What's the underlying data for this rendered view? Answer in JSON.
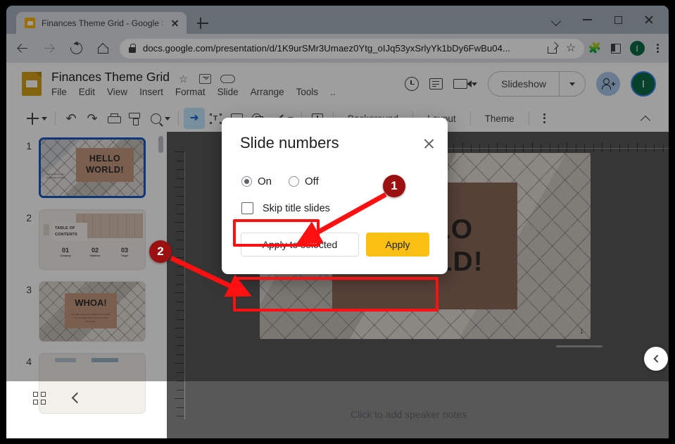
{
  "browser": {
    "tab": {
      "title": "Finances Theme Grid - Google Sli",
      "favicon": "slides-favicon",
      "close": "×"
    },
    "new_tab_label": "+",
    "window_controls": [
      "chevron-down",
      "minimize",
      "maximize",
      "close"
    ],
    "url": "docs.google.com/presentation/d/1K9urSMr3Umaez0Ytg_oIJq53yxSrlyYk1bDy6FwBu04...",
    "omnibox_icons": [
      "lock-icon",
      "share-icon",
      "bookmark-star-icon"
    ],
    "toolbar_icons": [
      "extensions-puzzle-icon",
      "side-panel-icon",
      "profile-avatar",
      "chrome-menu-icon"
    ],
    "profile_initial": "I"
  },
  "slides": {
    "doc_title": "Finances Theme Grid",
    "title_icons": [
      "star-icon",
      "move-to-folder-icon",
      "cloud-saved-icon"
    ],
    "menus": [
      "File",
      "Edit",
      "View",
      "Insert",
      "Format",
      "Slide",
      "Arrange",
      "Tools",
      ".."
    ],
    "header_right": {
      "history_icon": "version-history-icon",
      "comment_icon": "comment-icon",
      "meet_icon": "meet-camera-icon",
      "slideshow_label": "Slideshow",
      "share_icon": "person-add-icon",
      "avatar_initial": "I"
    },
    "toolbar": {
      "new_slide": "add-slide-icon",
      "undo": "undo-icon",
      "redo": "redo-icon",
      "print": "print-icon",
      "paint_format": "paint-format-icon",
      "zoom": "zoom-icon",
      "select": "cursor-select-icon",
      "textbox": "text-box-icon",
      "image": "insert-image-icon",
      "shape": "insert-shape-icon",
      "line": "insert-line-icon",
      "comment": "add-comment-icon",
      "background_label": "Background",
      "layout_label": "Layout",
      "theme_label": "Theme",
      "more_label": "more-options-icon",
      "collapse_label": "collapse-toolbar-icon"
    },
    "filmstrip": [
      {
        "number": "1",
        "title_line1": "HELLO",
        "title_line2": "WORLD!",
        "selected": true,
        "caption": "Here is where your presentation begins"
      },
      {
        "number": "2",
        "title_line1": "TABLE OF",
        "title_line2": "CONTENTS",
        "selected": false,
        "columns": [
          {
            "num": "01",
            "label": "Company"
          },
          {
            "num": "02",
            "label": "Statistics"
          },
          {
            "num": "03",
            "label": "Target"
          }
        ]
      },
      {
        "number": "3",
        "title_line1": "WHOA!",
        "title_line2": "",
        "selected": false,
        "caption": "This slide is perfect to begin a new section. You can write a title here and a brief description."
      },
      {
        "number": "4",
        "title_line1": "",
        "title_line2": "",
        "selected": false
      }
    ],
    "canvas": {
      "line1": "HELLO",
      "line2": "WORLD!",
      "page_number": "1"
    },
    "notes_placeholder": "Click to add speaker notes",
    "bottom_icons": {
      "grid_view": "grid-view-icon",
      "collapse_filmstrip": "collapse-left-icon",
      "open_panel": "open-side-panel-icon"
    }
  },
  "dialog": {
    "title": "Slide numbers",
    "close_icon": "close-icon",
    "radio_on": {
      "label": "On",
      "selected": true
    },
    "radio_off": {
      "label": "Off",
      "selected": false
    },
    "checkbox": {
      "label": "Skip title slides",
      "checked": false
    },
    "apply_to_selected_label": "Apply to selected",
    "apply_label": "Apply",
    "accent_color": "#f9c013"
  },
  "annotations": {
    "badge1": "1",
    "badge2": "2",
    "highlight_color": "#ff1010",
    "badge_color": "#9b1010"
  }
}
